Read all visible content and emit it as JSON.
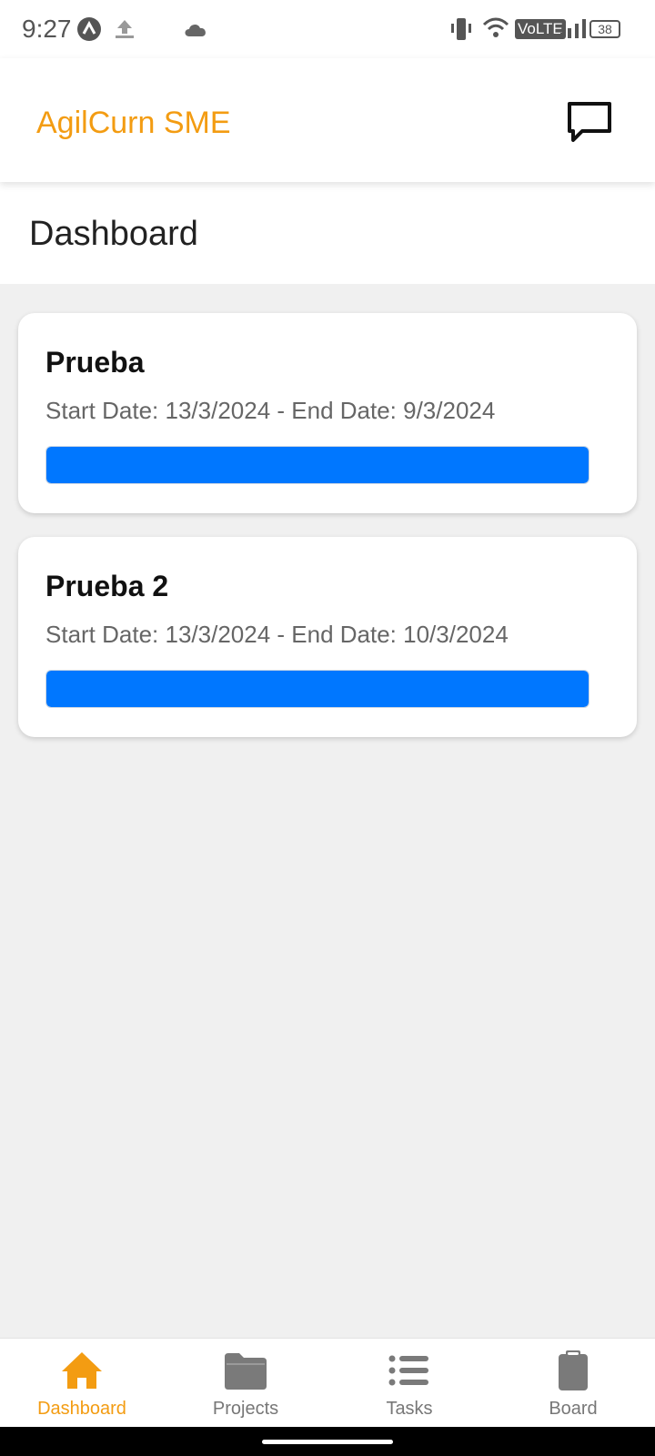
{
  "status_bar": {
    "time": "9:27",
    "battery": "38",
    "network": "VoLTE",
    "icons": [
      "app-notification-icon",
      "upload-icon",
      "cloud-icon",
      "vibrate-icon",
      "wifi-icon",
      "volte-icon",
      "signal-icon",
      "battery-icon"
    ]
  },
  "app_bar": {
    "title": "AgilCurn SME",
    "title_color": "#f39c12",
    "chat_icon": "chat-bubble-icon"
  },
  "page": {
    "title": "Dashboard"
  },
  "projects": [
    {
      "name": "Prueba",
      "dates": "Start Date: 13/3/2024 - End Date: 9/3/2024",
      "progress": 1.0,
      "progress_color": "#0077ff"
    },
    {
      "name": "Prueba 2",
      "dates": "Start Date: 13/3/2024 - End Date: 10/3/2024",
      "progress": 1.0,
      "progress_color": "#0077ff"
    }
  ],
  "bottom_nav": {
    "items": [
      {
        "label": "Dashboard",
        "icon": "home-icon",
        "active": true
      },
      {
        "label": "Projects",
        "icon": "folder-icon",
        "active": false
      },
      {
        "label": "Tasks",
        "icon": "list-icon",
        "active": false
      },
      {
        "label": "Board",
        "icon": "clipboard-icon",
        "active": false
      }
    ],
    "active_color": "#f39c12",
    "inactive_color": "#777777"
  }
}
